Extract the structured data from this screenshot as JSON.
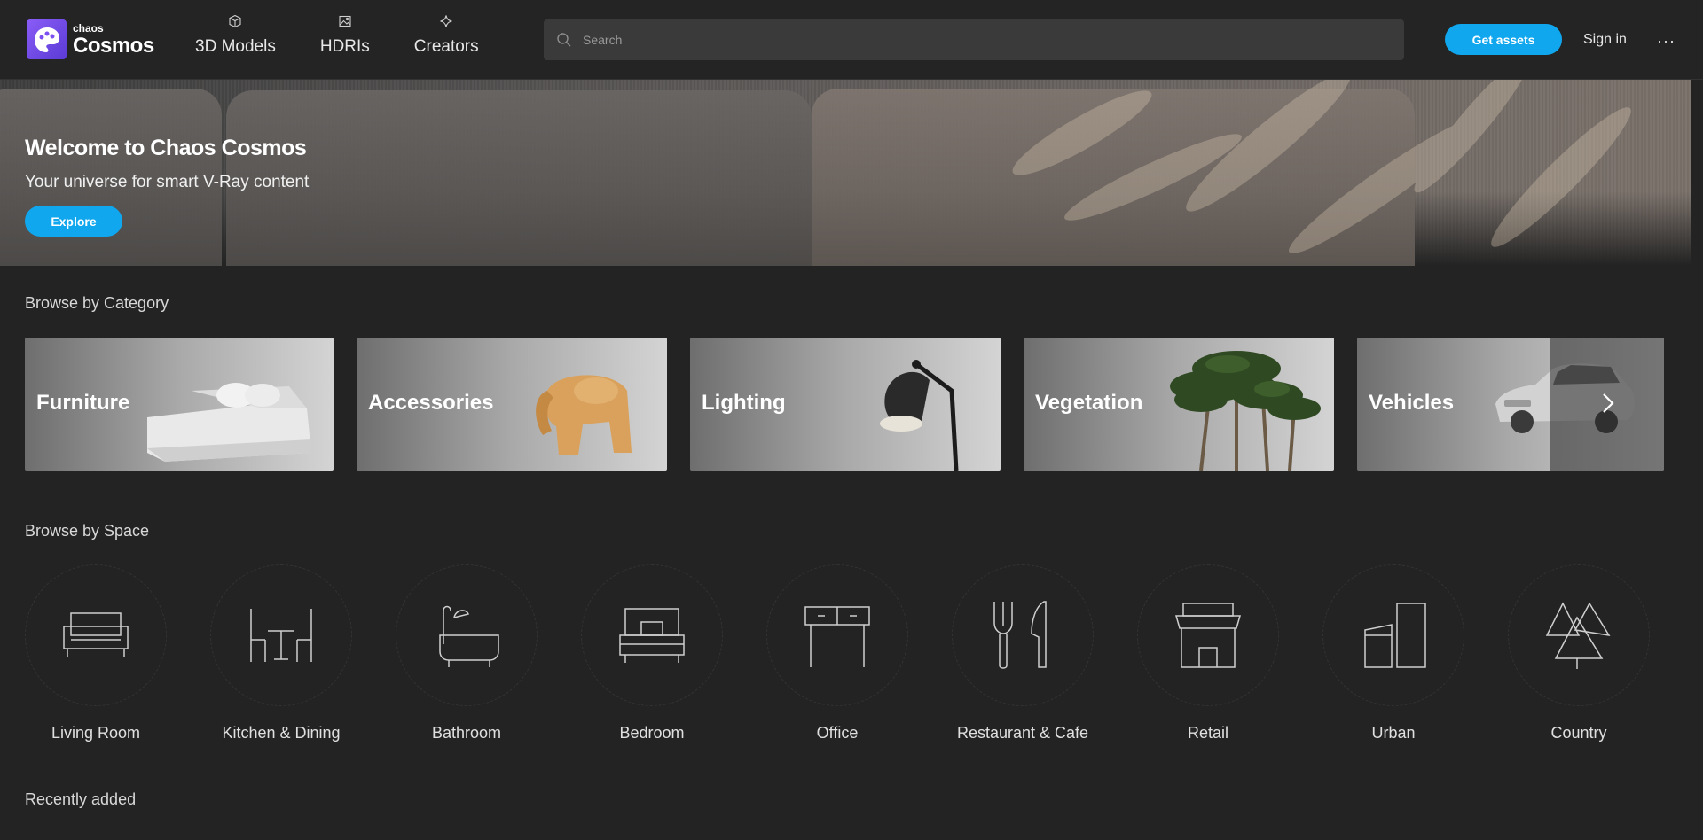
{
  "header": {
    "logo_small": "chaos",
    "logo_big": "Cosmos",
    "nav": [
      {
        "label": "3D Models",
        "icon": "cube-icon"
      },
      {
        "label": "HDRIs",
        "icon": "image-icon"
      },
      {
        "label": "Creators",
        "icon": "sparkle-icon"
      }
    ],
    "search_placeholder": "Search",
    "get_assets_label": "Get assets",
    "sign_in_label": "Sign in",
    "more_label": "···"
  },
  "hero": {
    "title": "Welcome to Chaos Cosmos",
    "subtitle": "Your universe for smart V-Ray content",
    "explore_label": "Explore"
  },
  "browse_category": {
    "title": "Browse by Category",
    "items": [
      {
        "label": "Furniture"
      },
      {
        "label": "Accessories"
      },
      {
        "label": "Lighting"
      },
      {
        "label": "Vegetation"
      },
      {
        "label": "Vehicles"
      }
    ]
  },
  "browse_space": {
    "title": "Browse by Space",
    "items": [
      {
        "label": "Living Room",
        "icon": "sofa-icon"
      },
      {
        "label": "Kitchen & Dining",
        "icon": "dining-table-icon"
      },
      {
        "label": "Bathroom",
        "icon": "bathtub-icon"
      },
      {
        "label": "Bedroom",
        "icon": "bed-icon"
      },
      {
        "label": "Office",
        "icon": "desk-icon"
      },
      {
        "label": "Restaurant & Cafe",
        "icon": "fork-knife-icon"
      },
      {
        "label": "Retail",
        "icon": "storefront-icon"
      },
      {
        "label": "Urban",
        "icon": "buildings-icon"
      },
      {
        "label": "Country",
        "icon": "trees-icon"
      }
    ]
  },
  "recently_added": {
    "title": "Recently added"
  },
  "colors": {
    "accent": "#10a7ee",
    "background": "#232323",
    "logo": "#7c4ff0"
  }
}
